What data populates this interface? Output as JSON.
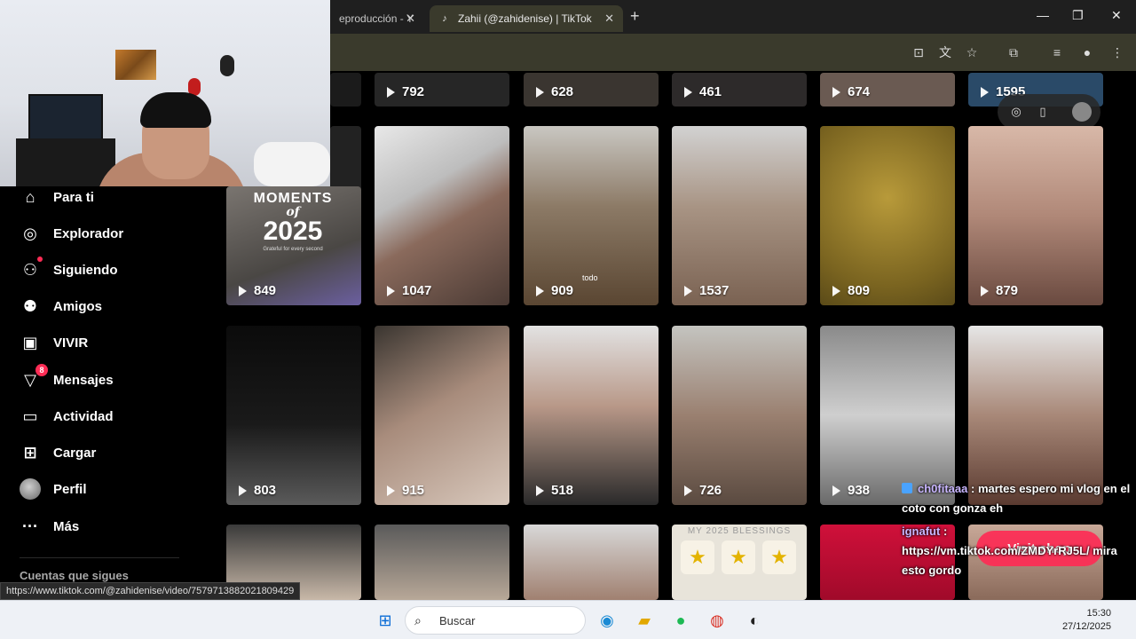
{
  "browser": {
    "tabs": [
      {
        "label": "eproducción - Y",
        "active": false
      },
      {
        "label": "Zahii (@zahidenise) | TikTok",
        "active": true
      }
    ],
    "new_tab": "+",
    "window_controls": {
      "minimize": "—",
      "maximize": "❐",
      "close": "✕"
    }
  },
  "sidebar": {
    "items": [
      {
        "label": "Para ti",
        "icon": "home-icon"
      },
      {
        "label": "Explorador",
        "icon": "compass-icon"
      },
      {
        "label": "Siguiendo",
        "icon": "following-icon"
      },
      {
        "label": "Amigos",
        "icon": "friends-icon"
      },
      {
        "label": "VIVIR",
        "icon": "live-icon"
      },
      {
        "label": "Mensajes",
        "icon": "messages-icon",
        "badge": "8"
      },
      {
        "label": "Actividad",
        "icon": "activity-icon"
      },
      {
        "label": "Cargar",
        "icon": "upload-icon"
      },
      {
        "label": "Perfil",
        "icon": "avatar"
      },
      {
        "label": "Más",
        "icon": "more-icon"
      }
    ],
    "following_label": "Cuentas que sigues"
  },
  "videos": {
    "row0": [
      "792",
      "628",
      "461",
      "674",
      "1595"
    ],
    "row1": [
      "849",
      "1047",
      "909",
      "1537",
      "809",
      "879"
    ],
    "row2": [
      "803",
      "915",
      "518",
      "726",
      "938"
    ],
    "moments": {
      "line1": "MOMENTS",
      "line2": "of",
      "line3": "2025",
      "line4": "Grateful for every second"
    },
    "tile_caption": "todo",
    "blessings": "MY 2025 BLESSINGS"
  },
  "overlay": {
    "visit_button": "Visit shop",
    "chat": [
      {
        "user": "ch0fitaaa",
        "text": ": martes espero mi vlog en el coto con gonza eh"
      },
      {
        "user": "ignafut",
        "text": ": https://vm.tiktok.com/ZMDYrRJ5L/ mira esto gordo"
      }
    ]
  },
  "status_url": "https://www.tiktok.com/@zahidenise/video/7579713882021809429",
  "taskbar": {
    "search_placeholder": "Buscar",
    "time": "15:30",
    "date": "27/12/2025"
  }
}
